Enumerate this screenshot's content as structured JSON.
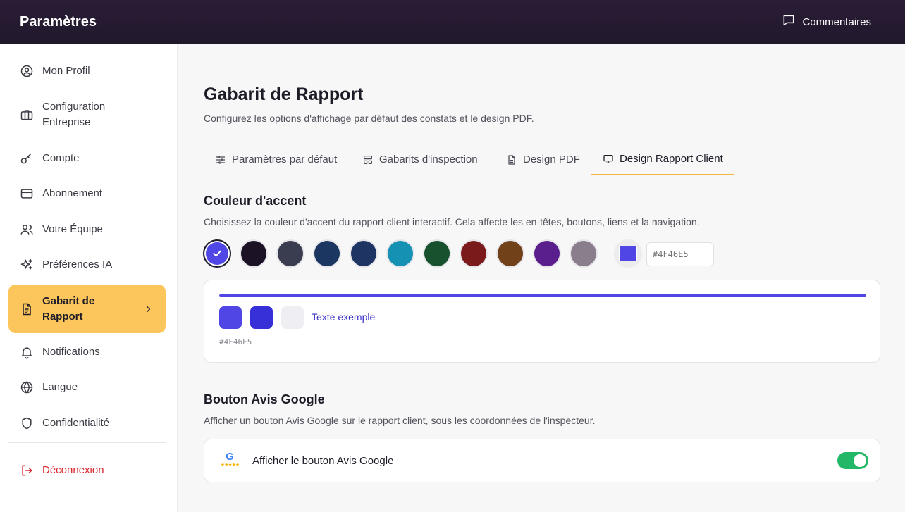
{
  "header": {
    "title": "Paramètres",
    "feedback_label": "Commentaires"
  },
  "sidebar": {
    "items": [
      {
        "label": "Mon Profil",
        "icon": "user-circle-icon"
      },
      {
        "label": "Configuration Entreprise",
        "icon": "briefcase-icon"
      },
      {
        "label": "Compte",
        "icon": "key-icon"
      },
      {
        "label": "Abonnement",
        "icon": "credit-card-icon"
      },
      {
        "label": "Votre Équipe",
        "icon": "users-icon"
      },
      {
        "label": "Préférences IA",
        "icon": "sparkles-icon"
      },
      {
        "label": "Gabarit de Rapport",
        "icon": "document-icon",
        "active": true
      },
      {
        "label": "Notifications",
        "icon": "bell-icon"
      },
      {
        "label": "Langue",
        "icon": "globe-icon"
      },
      {
        "label": "Confidentialité",
        "icon": "shield-icon"
      }
    ],
    "logout_label": "Déconnexion"
  },
  "main": {
    "title": "Gabarit de Rapport",
    "subtitle": "Configurez les options d'affichage par défaut des constats et le design PDF.",
    "tabs": [
      {
        "label": "Paramètres par défaut",
        "icon": "sliders-icon"
      },
      {
        "label": "Gabarits d'inspection",
        "icon": "layout-icon"
      },
      {
        "label": "Design PDF",
        "icon": "file-icon"
      },
      {
        "label": "Design Rapport Client",
        "icon": "monitor-icon",
        "active": true
      }
    ],
    "accent": {
      "title": "Couleur d'accent",
      "description": "Choisissez la couleur d'accent du rapport client interactif. Cela affecte les en-têtes, boutons, liens et la navigation.",
      "swatches": [
        "#4f46e5",
        "#1c1226",
        "#3a3d4f",
        "#1b3660",
        "#1e3563",
        "#1591b3",
        "#17512e",
        "#7a1a1a",
        "#71411a",
        "#5a1f8c",
        "#8a7e8c"
      ],
      "selected": "#4f46e5",
      "hex_placeholder": "#4F46E5"
    },
    "preview": {
      "primary": "#4f46e5",
      "dark": "#3730d8",
      "light": "#efeff3",
      "sample_text": "Texte exemple",
      "sample_color": "#3730c8",
      "hex_label": "#4F46E5"
    },
    "google": {
      "title": "Bouton Avis Google",
      "description": "Afficher un bouton Avis Google sur le rapport client, sous les coordonnées de l'inspecteur.",
      "toggle_label": "Afficher le bouton Avis Google",
      "logo_letter": "G",
      "enabled": true,
      "toggle_color": "#22b868"
    }
  }
}
